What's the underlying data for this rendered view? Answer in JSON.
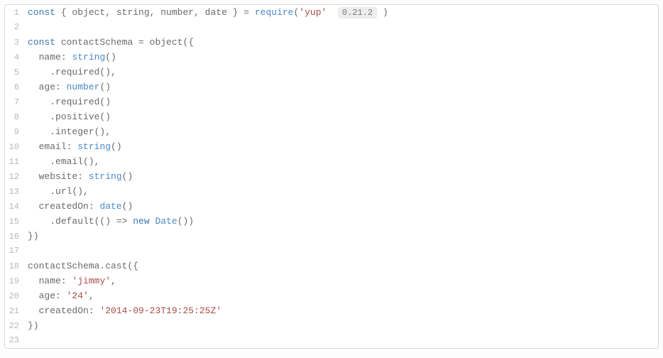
{
  "code": {
    "requireCall": "require",
    "packageName": "'yup'",
    "packageVersion": "0.21.2",
    "kw_const": "const",
    "kw_new": "new",
    "destruct": "{ object, string, number, date }",
    "schemaVar": "contactSchema",
    "objectOpen": "object({",
    "fields": {
      "name_key": "name",
      "name_type": "string",
      "age_key": "age",
      "age_type": "number",
      "email_key": "email",
      "email_type": "string",
      "website_key": "website",
      "website_type": "string",
      "createdOn_key": "createdOn",
      "createdOn_type": "date"
    },
    "methods": {
      "required": ".required()",
      "required_comma": ".required(),",
      "positive": ".positive()",
      "integer": ".integer(),",
      "email": ".email(),",
      "url": ".url(),",
      "default_open": ".default(() => ",
      "default_close": "())"
    },
    "dateCtor": "Date",
    "closeBrace": "})",
    "cast": {
      "call": ".cast({",
      "name_key": "name",
      "name_val": "'jimmy'",
      "age_key": "age",
      "age_val": "'24'",
      "createdOn_key": "createdOn",
      "createdOn_val": "'2014-09-23T19:25:25Z'"
    },
    "lineNumbers": [
      "1",
      "2",
      "3",
      "4",
      "5",
      "6",
      "7",
      "8",
      "9",
      "10",
      "11",
      "12",
      "13",
      "14",
      "15",
      "16",
      "17",
      "18",
      "19",
      "20",
      "21",
      "22",
      "23"
    ]
  }
}
